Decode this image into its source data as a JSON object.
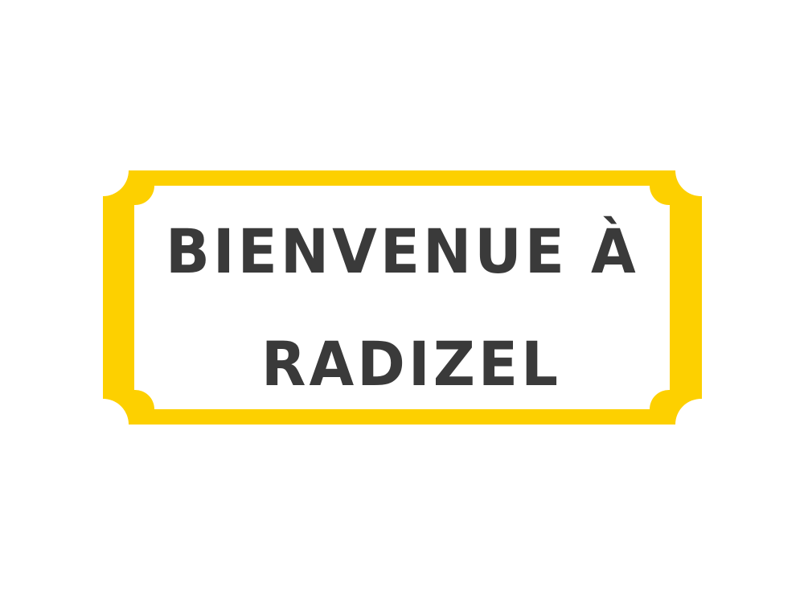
{
  "sign": {
    "line1": "BIENVENUE À",
    "line2": "RADIZEL",
    "frame_color": "#FDD000",
    "background_color": "#FFFFFF",
    "text_color": "#3A3A3A"
  }
}
